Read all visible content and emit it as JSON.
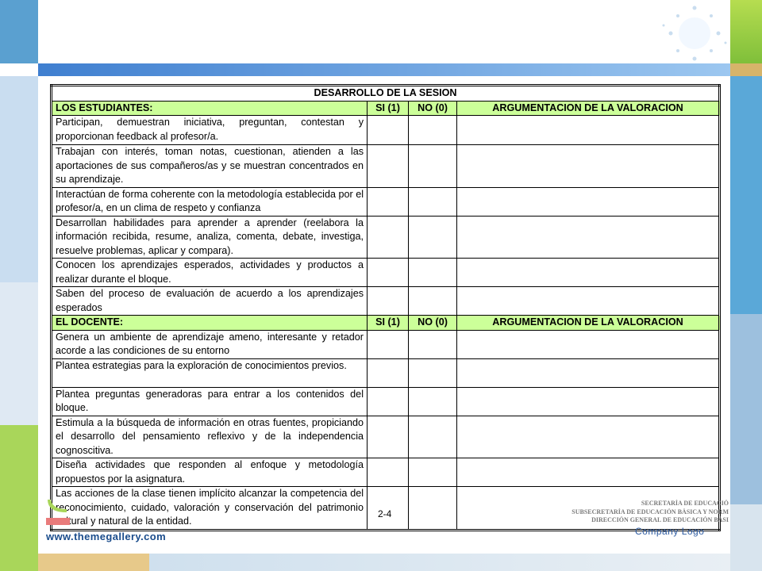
{
  "table": {
    "title": "DESARROLLO DE LA SESION",
    "sections": [
      {
        "header": [
          "LOS ESTUDIANTES:",
          "SI (1)",
          "NO (0)",
          "ARGUMENTACION DE LA VALORACION"
        ],
        "rows": [
          "Participan, demuestran iniciativa, preguntan, contestan y proporcionan feedback al profesor/a.",
          "Trabajan con interés, toman notas, cuestionan, atienden a las aportaciones de sus compañeros/as y se muestran concentrados en su aprendizaje.",
          "Interactúan de forma coherente con la metodología establecida por el profesor/a, en un clima de respeto y confianza",
          "Desarrollan habilidades para aprender a aprender (reelabora la información recibida, resume, analiza, comenta, debate, investiga, resuelve problemas, aplicar y compara).",
          "Conocen los aprendizajes esperados, actividades y productos a realizar durante el bloque.",
          "Saben del proceso de evaluación de acuerdo a los aprendizajes esperados"
        ]
      },
      {
        "header": [
          "EL DOCENTE:",
          "SI (1)",
          "NO (0)",
          "ARGUMENTACION DE LA VALORACION"
        ],
        "rows": [
          "Genera un ambiente de aprendizaje ameno, interesante y retador acorde a las condiciones de su entorno",
          "Plantea estrategias para la exploración de conocimientos previos.",
          "Plantea preguntas generadoras para entrar a los contenidos del bloque.",
          "Estimula a la búsqueda de información en otras fuentes, propiciando el desarrollo del pensamiento reflexivo y de la independencia cognoscitiva.",
          "Diseña actividades que responden al enfoque y metodología propuestos por la asignatura.",
          "Las acciones de la clase tienen implícito alcanzar la competencia del reconocimiento, cuidado, valoración y conservación del patrimonio cultural y natural de la entidad."
        ]
      }
    ]
  },
  "page_number": "2-4",
  "seal_lines": [
    "SECRETARÍA DE EDUCACIÓ",
    "SUBSECRETARÍA DE EDUCACIÓN BÁSICA Y NORM",
    "DIRECCIÓN GENERAL DE EDUCACIÓN BÁSI"
  ],
  "footer": {
    "url": "www.themegallery.com",
    "logo": "Company Logo"
  },
  "colors": {
    "header_green": "#ccff99",
    "accent_blue": "#3f7fd0",
    "accent_green": "#a9d65a"
  }
}
